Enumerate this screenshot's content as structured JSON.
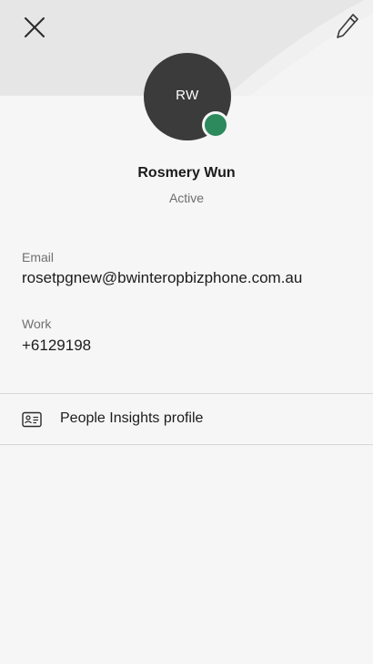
{
  "profile": {
    "initials": "RW",
    "name": "Rosmery Wun",
    "status": "Active",
    "presence_color": "#2c8a5d"
  },
  "contact": {
    "email_label": "Email",
    "email_value": "rosetpgnew@bwinteropbizphone.com.au",
    "work_label": "Work",
    "work_value": "+6129198"
  },
  "links": {
    "insights_label": "People Insights profile"
  },
  "icons": {
    "close": "close-icon",
    "edit": "pencil-icon",
    "insights": "contact-card-icon"
  }
}
